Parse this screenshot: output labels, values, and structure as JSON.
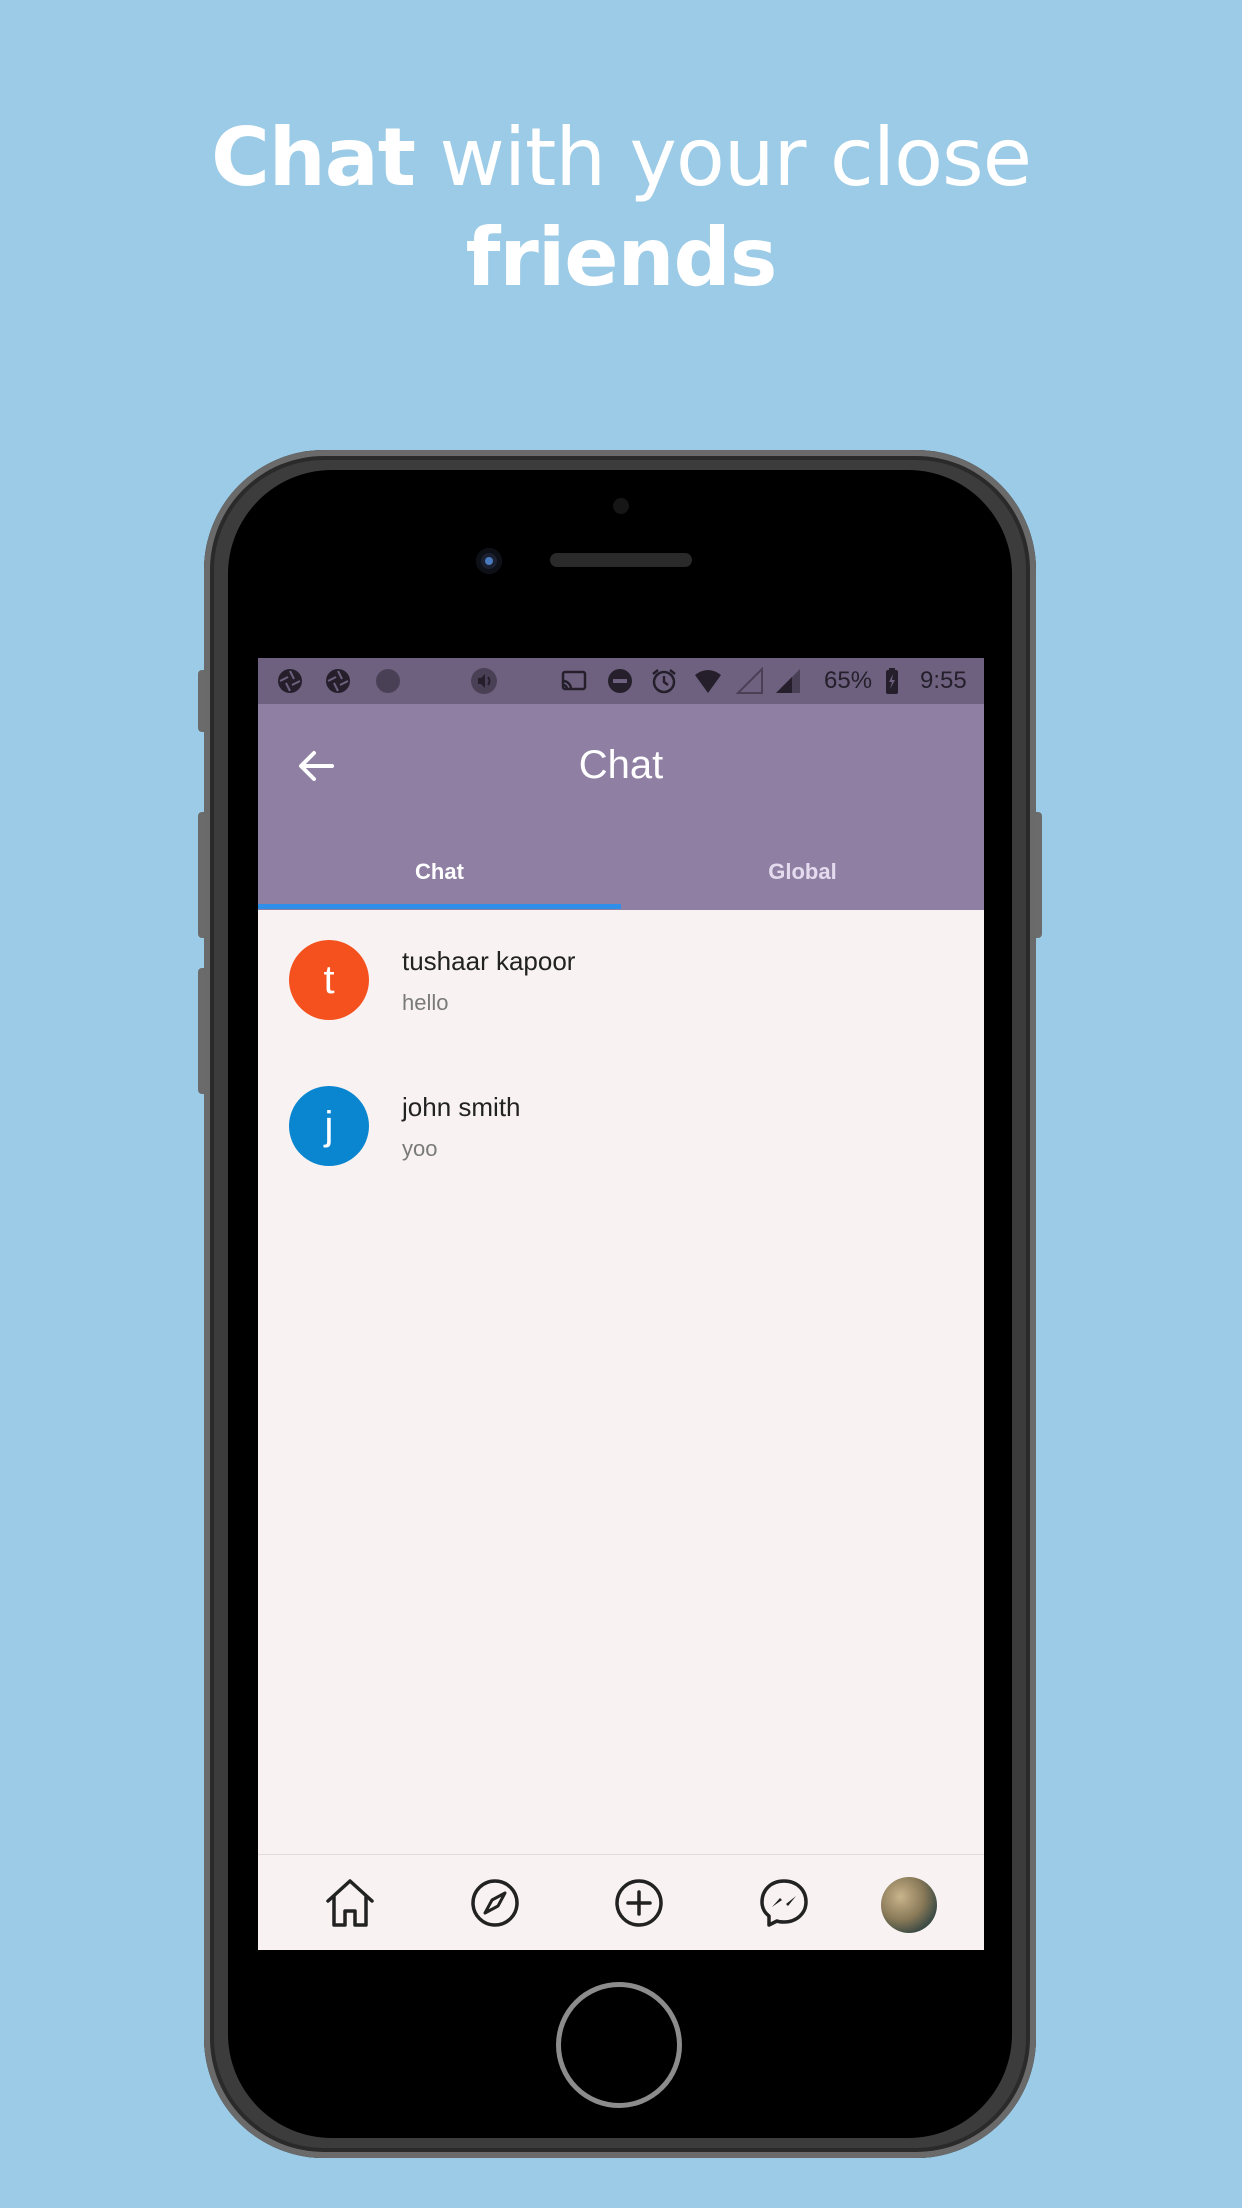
{
  "headline": {
    "part1_bold": "Chat",
    "part2": " with your close",
    "part3_bold": "friends"
  },
  "statusbar": {
    "battery": "65%",
    "time": "9:55",
    "icons": [
      "aperture-icon",
      "aperture-icon",
      "circle-icon",
      "volume-icon",
      "cast-icon",
      "do-not-disturb-icon",
      "alarm-icon",
      "wifi-icon",
      "signal-empty-icon",
      "signal-icon",
      "battery-charging-icon"
    ]
  },
  "appbar": {
    "title": "Chat",
    "back_icon": "arrow-back-icon"
  },
  "tabs": [
    {
      "label": "Chat",
      "selected": true
    },
    {
      "label": "Global",
      "selected": false
    }
  ],
  "chats": [
    {
      "initial": "t",
      "name": "tushaar kapoor",
      "last_message": "hello",
      "avatar_color": "#f4511e"
    },
    {
      "initial": "j",
      "name": "john smith",
      "last_message": "yoo",
      "avatar_color": "#0a86d0"
    }
  ],
  "bottom_nav": {
    "items": [
      "home-icon",
      "compass-icon",
      "add-circle-icon",
      "messenger-icon",
      "profile-avatar"
    ]
  },
  "colors": {
    "background": "#9bcbe6",
    "appbar": "#8f7fa3",
    "statusbar": "#6e617f",
    "tab_indicator": "#2f8fe8",
    "screen_bg": "#f8f3f2"
  }
}
